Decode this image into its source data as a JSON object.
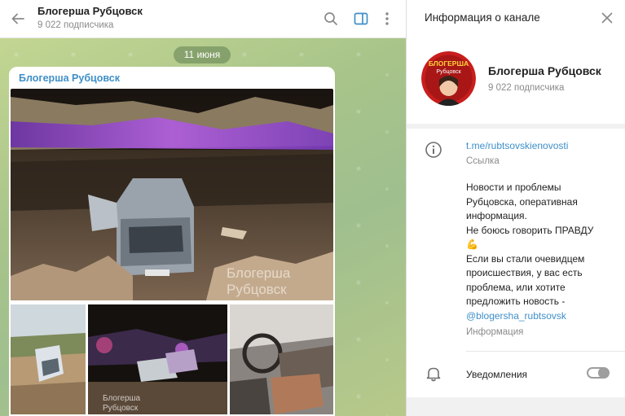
{
  "chat": {
    "title": "Блогерша Рубцовск",
    "subscribers": "9 022 подписчика",
    "date": "11 июня",
    "message": {
      "author": "Блогерша Рубцовск",
      "photo_watermark_line1": "Блогерша",
      "photo_watermark_line2": "Рубцовск",
      "small_watermark_line1": "Блогерша",
      "small_watermark_line2": "Рубцовск"
    }
  },
  "info_panel": {
    "title": "Информация о канале",
    "profile": {
      "name": "Блогерша Рубцовск",
      "subscribers": "9 022 подписчика",
      "avatar_text_line1": "БЛОГЕРША",
      "avatar_text_line2": "Рубцовск"
    },
    "link": {
      "url": "t.me/rubtsovskienovosti",
      "label": "Ссылка"
    },
    "description": {
      "lines": [
        "Новости и проблемы",
        "Рубцовска, оперативная",
        "информация.",
        "Не боюсь говорить ПРАВДУ",
        "💪",
        "Если вы стали очевидцем",
        "происшествия, у вас есть",
        "проблема, или хотите",
        "предложить новость -"
      ],
      "mention": "@blogersha_rubtsovsk",
      "label": "Информация"
    },
    "notifications": {
      "label": "Уведомления",
      "enabled": false
    }
  },
  "colors": {
    "accent": "#3f8fc9",
    "chat_bg": "#a8c48a",
    "date_pill": "#6f8f58"
  },
  "icons": [
    "back-arrow-icon",
    "search-icon",
    "sidebar-toggle-icon",
    "more-vertical-icon",
    "close-icon",
    "info-icon",
    "bell-icon"
  ]
}
